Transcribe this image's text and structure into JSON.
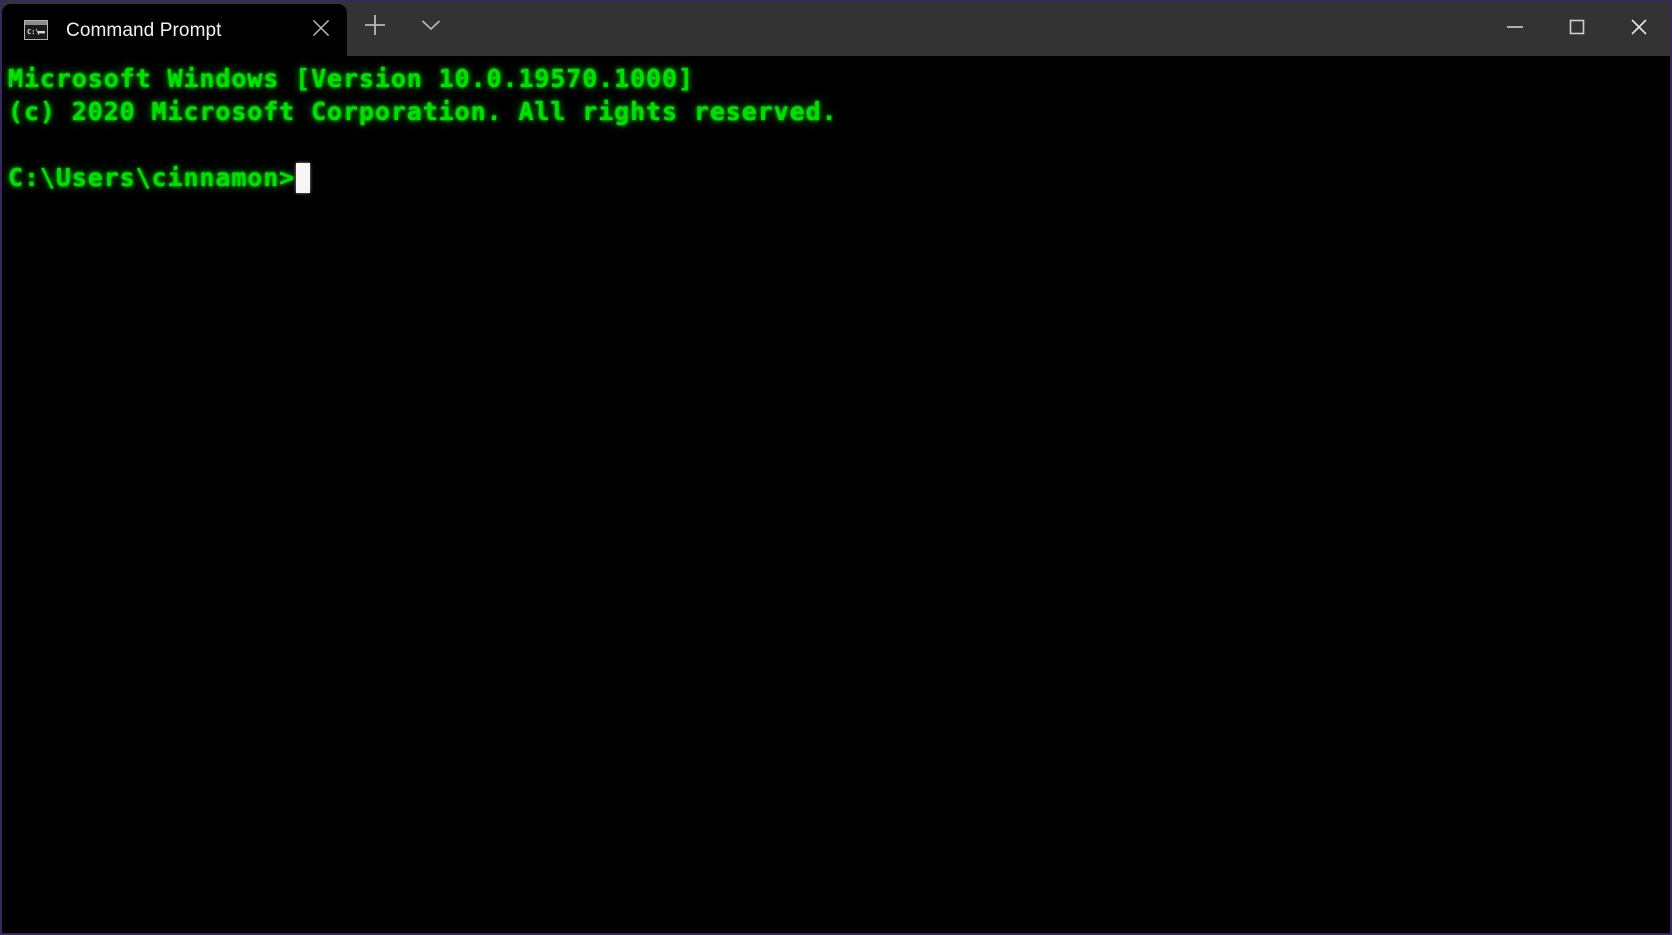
{
  "window": {
    "title": "Command Prompt",
    "border_color": "#37295c",
    "titlebar_color": "#333333",
    "controls": [
      {
        "name": "minimize",
        "glyph": "minimize-icon",
        "label": "Minimize"
      },
      {
        "name": "maximize",
        "glyph": "maximize-icon",
        "label": "Maximize"
      },
      {
        "name": "close",
        "glyph": "close-icon",
        "label": "Close"
      }
    ]
  },
  "tabbar": {
    "tabs": [
      {
        "label": "Command Prompt",
        "icon": "console-window-icon",
        "active": true,
        "close_label": "Close tab"
      }
    ],
    "new_tab_label": "New tab",
    "new_tab_icon": "plus-icon",
    "dropdown_label": "Open new tab dropdown",
    "dropdown_icon": "chevron-down-icon"
  },
  "terminal": {
    "background_color": "#000000",
    "foreground_color": "#00e000",
    "cursor_color": "#f6f6f6",
    "cursor_style": "block",
    "lines": [
      "Microsoft Windows [Version 10.0.19570.1000]",
      "(c) 2020 Microsoft Corporation. All rights reserved.",
      "",
      ""
    ],
    "prompt": "C:\\Users\\cinnamon>",
    "input": ""
  }
}
